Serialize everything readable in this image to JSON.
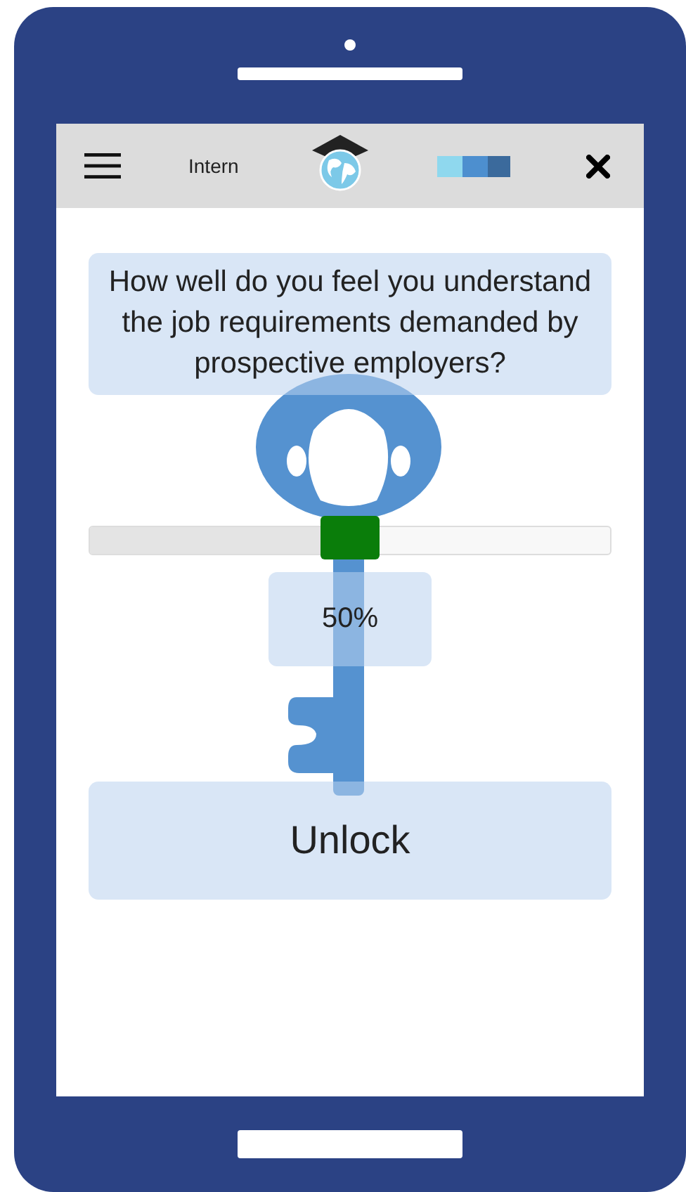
{
  "header": {
    "title": "Intern"
  },
  "question": "How well do you feel you understand the job requirements demanded by prospective employers?",
  "slider": {
    "level": 0.5,
    "reading": "50%"
  },
  "unlock_button": "Unlock"
}
